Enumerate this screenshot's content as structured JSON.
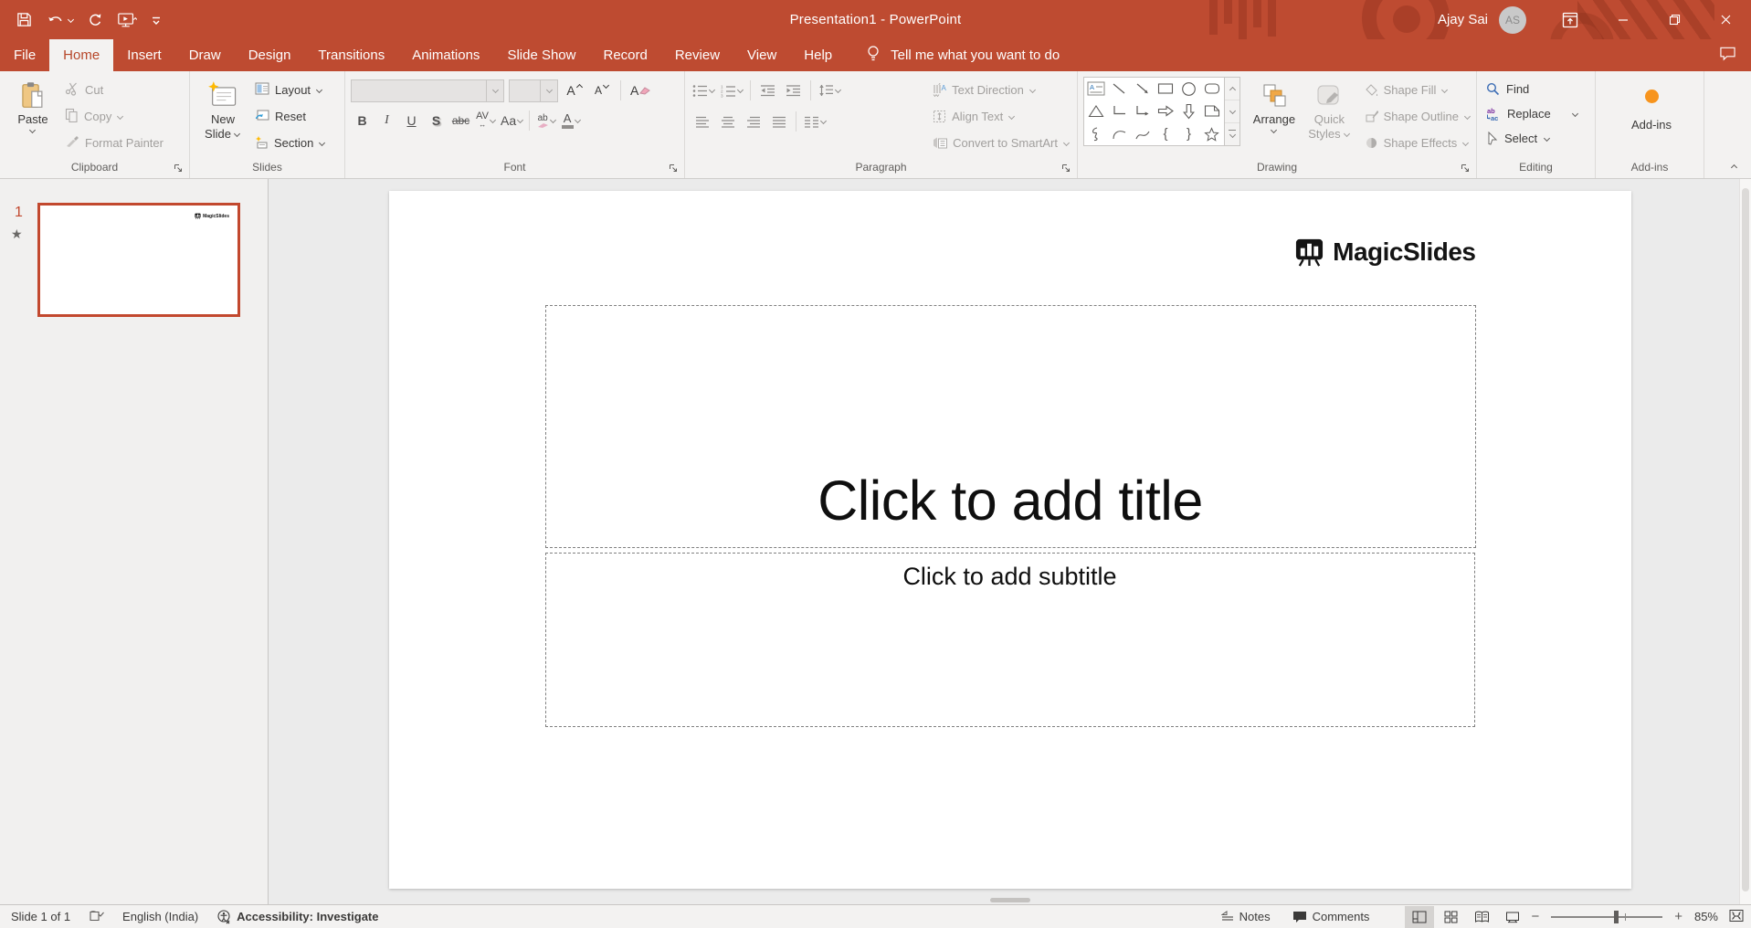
{
  "colors": {
    "brand_red": "#BE4B31",
    "active_tab_text": "#B7472A",
    "ribbon_bg": "#F3F2F1",
    "disabled_text": "#A19F9D",
    "selection_red": "#C2482E",
    "addin_orange": "#F7941D",
    "paste_clipboard_tan": "#EFC783"
  },
  "titlebar": {
    "title": "Presentation1 - PowerPoint",
    "user_name": "Ajay Sai",
    "user_initials": "AS"
  },
  "menubar": {
    "tabs": [
      "File",
      "Home",
      "Insert",
      "Draw",
      "Design",
      "Transitions",
      "Animations",
      "Slide Show",
      "Record",
      "Review",
      "View",
      "Help"
    ],
    "active_tab": "Home",
    "tell_me": "Tell me what you want to do"
  },
  "ribbon": {
    "clipboard": {
      "group_label": "Clipboard",
      "paste": "Paste",
      "cut": "Cut",
      "copy": "Copy",
      "format_painter": "Format Painter"
    },
    "slides": {
      "group_label": "Slides",
      "new_line1": "New",
      "new_line2": "Slide",
      "layout": "Layout",
      "reset": "Reset",
      "section": "Section"
    },
    "font": {
      "group_label": "Font",
      "bold": "B",
      "italic": "I",
      "underline": "U",
      "shadow": "S",
      "strikethrough": "abc",
      "char_spacing": "AV",
      "change_case": "Aa",
      "highlight": "ab",
      "font_color": "A",
      "grow": "A",
      "shrink": "A",
      "clear": "A"
    },
    "paragraph": {
      "group_label": "Paragraph",
      "text_direction": "Text Direction",
      "align_text": "Align Text",
      "convert_smartart": "Convert to SmartArt"
    },
    "drawing": {
      "group_label": "Drawing",
      "arrange": "Arrange",
      "quick1": "Quick",
      "quick2": "Styles",
      "shape_fill": "Shape Fill",
      "shape_outline": "Shape Outline",
      "shape_effects": "Shape Effects",
      "shapes": [
        "text-box",
        "line",
        "arrow",
        "rectangle",
        "oval",
        "rounded-rectangle",
        "triangle",
        "elbow-connector",
        "elbow-arrow-connector",
        "right-arrow",
        "down-arrow",
        "snip-corner-rectangle",
        "scribble",
        "arc",
        "curve",
        "left-brace",
        "right-brace",
        "star"
      ]
    },
    "editing": {
      "group_label": "Editing",
      "find": "Find",
      "replace": "Replace",
      "select": "Select"
    },
    "addins": {
      "group_label": "Add-ins",
      "button": "Add-ins"
    }
  },
  "slide_panel": {
    "slide_number": "1"
  },
  "slide": {
    "logo_text": "MagicSlides",
    "title_placeholder": "Click to add title",
    "subtitle_placeholder": "Click to add subtitle"
  },
  "statusbar": {
    "slide_indicator": "Slide 1 of 1",
    "language": "English (India)",
    "accessibility": "Accessibility: Investigate",
    "notes": "Notes",
    "comments": "Comments",
    "zoom_level": "85%"
  },
  "icons": {
    "qat": [
      "save-icon",
      "undo-icon",
      "redo-icon",
      "slideshow-from-start-icon",
      "customize-qat-icon"
    ],
    "titlebar": [
      "ribbon-display-options-icon",
      "minimize-icon",
      "restore-icon",
      "close-icon"
    ],
    "menubar": [
      "lightbulb-icon",
      "comment-icon"
    ],
    "statusbar": [
      "spellcheck-icon",
      "accessibility-icon",
      "notes-icon",
      "comments-icon",
      "normal-view-icon",
      "slide-sorter-icon",
      "reading-view-icon",
      "slideshow-view-icon",
      "zoom-out-icon",
      "zoom-in-icon",
      "fit-to-window-icon"
    ]
  }
}
